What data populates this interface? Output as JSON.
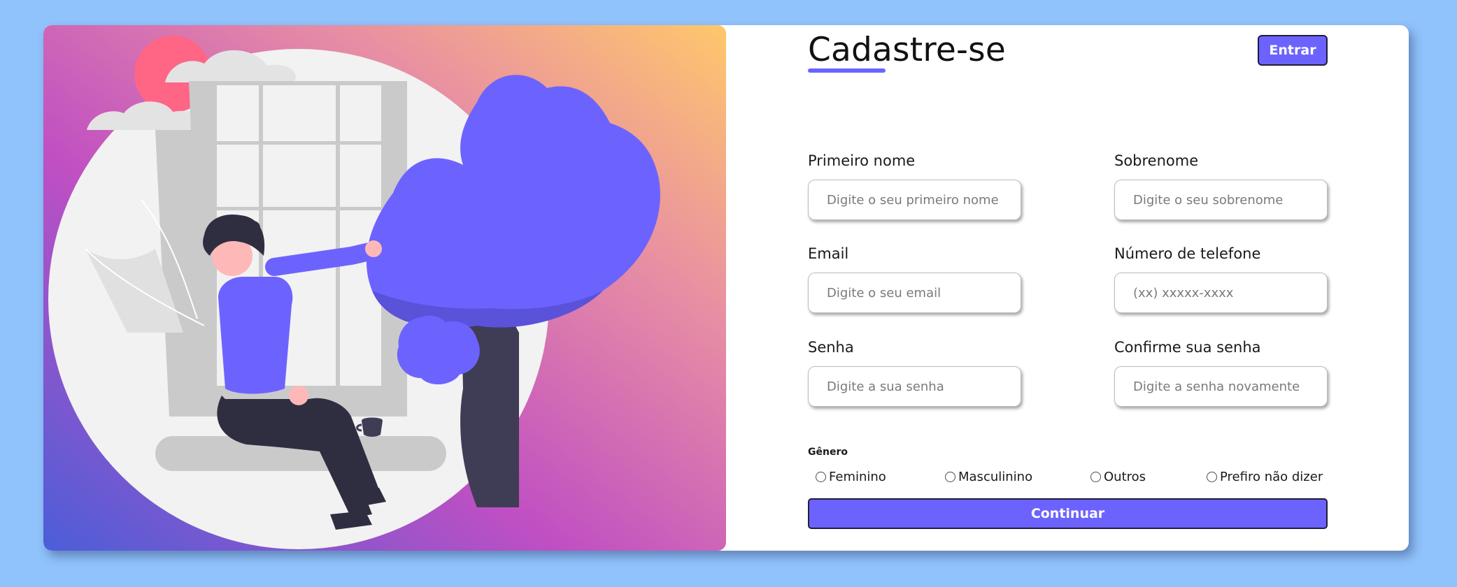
{
  "colors": {
    "page_background": "#90c2fb",
    "accent": "#6c63ff",
    "card_background": "#ffffff",
    "hero_gradient": [
      "#4b5ed8",
      "#c04fc3",
      "#e88fa3",
      "#ffc76b"
    ]
  },
  "illustration": {
    "icon": "woman-sitting-by-window-illustration"
  },
  "header": {
    "title": "Cadastre-se",
    "login_button": "Entrar"
  },
  "form": {
    "first_name": {
      "label": "Primeiro nome",
      "placeholder": "Digite o seu primeiro nome",
      "value": ""
    },
    "last_name": {
      "label": "Sobrenome",
      "placeholder": "Digite o seu sobrenome",
      "value": ""
    },
    "email": {
      "label": "Email",
      "placeholder": "Digite o seu email",
      "value": ""
    },
    "phone": {
      "label": "Número de telefone",
      "placeholder": "(xx) xxxxx-xxxx",
      "value": ""
    },
    "password": {
      "label": "Senha",
      "placeholder": "Digite a sua senha",
      "value": ""
    },
    "confirm_password": {
      "label": "Confirme sua senha",
      "placeholder": "Digite a senha novamente",
      "value": ""
    },
    "gender": {
      "title": "Gênero",
      "options": [
        {
          "label": "Feminino",
          "selected": false
        },
        {
          "label": "Masculinino",
          "selected": false
        },
        {
          "label": "Outros",
          "selected": false
        },
        {
          "label": "Prefiro não dizer",
          "selected": false
        }
      ]
    },
    "continue_button": "Continuar"
  }
}
